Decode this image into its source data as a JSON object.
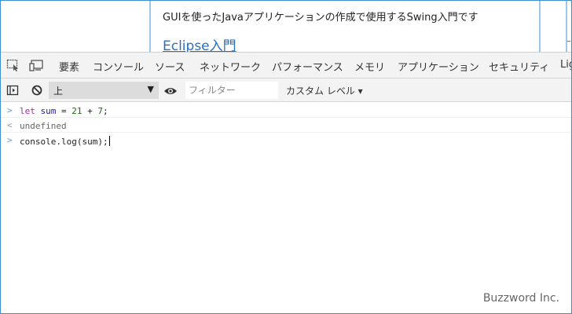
{
  "page": {
    "text": "GUIを使ったJavaアプリケーションの作成で使用するSwing入門です",
    "link": "Eclipse入門"
  },
  "devtools": {
    "tabs": [
      "要素",
      "コンソール",
      "ソース",
      "ネットワーク",
      "パフォーマンス",
      "メモリ",
      "アプリケーション",
      "セキュリティ",
      "Lig"
    ],
    "active_tab": "コンソール"
  },
  "toolbar": {
    "context": "上",
    "context_arrow": "▼",
    "filter_placeholder": "フィルター",
    "levels": "カスタム レベル ▾"
  },
  "console": {
    "input1": {
      "prompt": ">",
      "kw": "let",
      "var": "sum",
      "op1": "=",
      "n1": "21",
      "op2": "+",
      "n2": "7",
      "end": ";"
    },
    "output1": {
      "prompt": "<",
      "text": "undefined"
    },
    "input2": {
      "prompt": ">",
      "text": "console.log(sum);"
    }
  },
  "watermark": "Buzzword Inc."
}
